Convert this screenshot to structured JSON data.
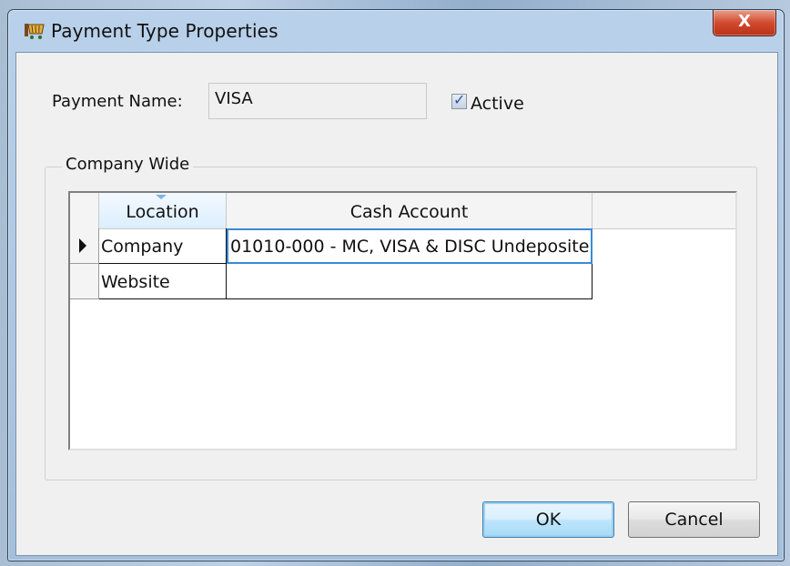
{
  "window": {
    "title": "Payment Type Properties",
    "close_glyph": "X",
    "icon": "cart-icon"
  },
  "form": {
    "payment_name_label": "Payment Name:",
    "payment_name_value": "VISA",
    "active_label": "Active",
    "active_checked": true
  },
  "group": {
    "title": "Company Wide",
    "columns": [
      "Location",
      "Cash Account"
    ],
    "rows": [
      {
        "location": "Company",
        "cash_account": "01010-000 - MC, VISA & DISC Undeposite",
        "current": true
      },
      {
        "location": "Website",
        "cash_account": "",
        "current": false
      }
    ]
  },
  "buttons": {
    "ok": "OK",
    "cancel": "Cancel"
  },
  "colors": {
    "accent": "#3a8ad8",
    "close_button": "#d24a2e"
  }
}
